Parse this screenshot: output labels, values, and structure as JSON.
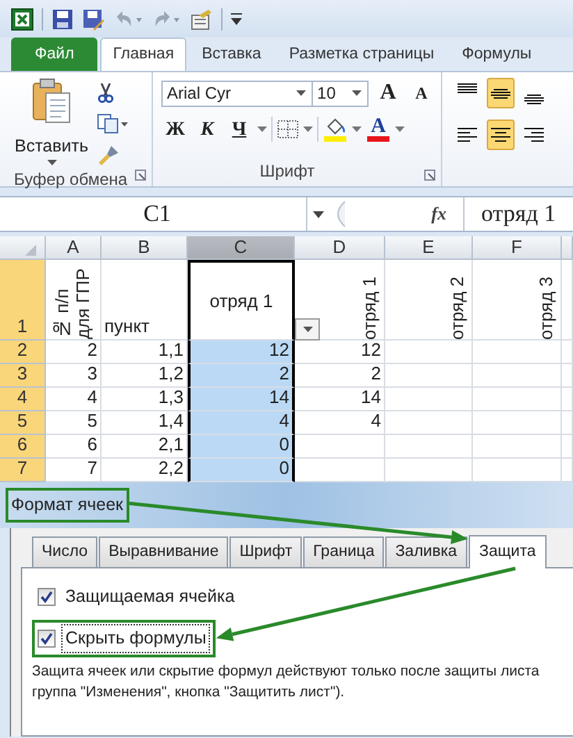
{
  "ribbon_tabs": [
    {
      "label": "Файл",
      "kind": "file",
      "selected": false
    },
    {
      "label": "Главная",
      "kind": "tab",
      "selected": true
    },
    {
      "label": "Вставка",
      "kind": "tab",
      "selected": false
    },
    {
      "label": "Разметка страницы",
      "kind": "tab",
      "selected": false
    },
    {
      "label": "Формулы",
      "kind": "tab",
      "selected": false
    }
  ],
  "clipboard": {
    "paste_label": "Вставить",
    "group_label": "Буфер обмена"
  },
  "font": {
    "font_name": "Arial Cyr",
    "font_size": "10",
    "grow_label": "A",
    "shrink_label": "A",
    "bold_label": "Ж",
    "italic_label": "К",
    "underline_label": "Ч",
    "color_label": "A",
    "group_label": "Шрифт"
  },
  "alignment": {
    "vertical": [
      {
        "kind": "top",
        "selected": false
      },
      {
        "kind": "middle",
        "selected": true
      },
      {
        "kind": "bottom",
        "selected": false
      }
    ],
    "horizontal": [
      {
        "kind": "left",
        "selected": false
      },
      {
        "kind": "center",
        "selected": true
      },
      {
        "kind": "right",
        "selected": false
      }
    ]
  },
  "formula_bar": {
    "name_box": "C1",
    "function_label": "fx",
    "formula": "отряд 1"
  },
  "sheet": {
    "columns": [
      {
        "label": "A",
        "selected": false
      },
      {
        "label": "B",
        "selected": false
      },
      {
        "label": "C",
        "selected": true
      },
      {
        "label": "D",
        "selected": false
      },
      {
        "label": "E",
        "selected": false
      },
      {
        "label": "F",
        "selected": false
      }
    ],
    "rows": [
      {
        "header": "1",
        "selected": true,
        "active": true,
        "cells": [
          {
            "text": "№ п/п для ГПР",
            "rotated": true
          },
          {
            "text": "пункт",
            "rotated": false
          },
          {
            "text": "отряд 1",
            "rotated": false,
            "filter": true
          },
          {
            "text": "отряд 1",
            "rotated": true
          },
          {
            "text": "отряд 2",
            "rotated": true
          },
          {
            "text": "отряд 3",
            "rotated": true
          }
        ]
      },
      {
        "header": "2",
        "selected": true,
        "active": false,
        "cells": [
          "2",
          "1,1",
          "12",
          "12",
          "",
          ""
        ]
      },
      {
        "header": "3",
        "selected": true,
        "active": false,
        "cells": [
          "3",
          "1,2",
          "2",
          "2",
          "",
          ""
        ]
      },
      {
        "header": "4",
        "selected": true,
        "active": false,
        "cells": [
          "4",
          "1,3",
          "14",
          "14",
          "",
          ""
        ]
      },
      {
        "header": "5",
        "selected": true,
        "active": false,
        "cells": [
          "5",
          "1,4",
          "4",
          "4",
          "",
          ""
        ]
      },
      {
        "header": "6",
        "selected": true,
        "active": false,
        "cells": [
          "6",
          "2,1",
          "0",
          "",
          "",
          " "
        ]
      },
      {
        "header": "7",
        "selected": true,
        "active": false,
        "cells": [
          "7",
          "2,2",
          "0",
          "",
          "",
          ""
        ]
      }
    ]
  },
  "dialog": {
    "title": "Формат ячеек",
    "title_highlighted": true,
    "tabs": [
      {
        "label": "Число",
        "selected": false,
        "highlighted": false
      },
      {
        "label": "Выравнивание",
        "selected": false,
        "highlighted": false
      },
      {
        "label": "Шрифт",
        "selected": false,
        "highlighted": false
      },
      {
        "label": "Граница",
        "selected": false,
        "highlighted": false
      },
      {
        "label": "Заливка",
        "selected": false,
        "highlighted": false
      },
      {
        "label": "Защита",
        "selected": true,
        "highlighted": true
      }
    ],
    "options": [
      {
        "label": "Защищаемая ячейка",
        "checked": true,
        "focused": false,
        "highlighted": false
      },
      {
        "label": "Скрыть формулы",
        "checked": true,
        "focused": true,
        "highlighted": true
      }
    ],
    "note_lines": [
      "Защита ячеек или скрытие формул действуют только после защиты листа",
      "группа \"Изменения\", кнопка \"Защитить лист\")."
    ]
  }
}
